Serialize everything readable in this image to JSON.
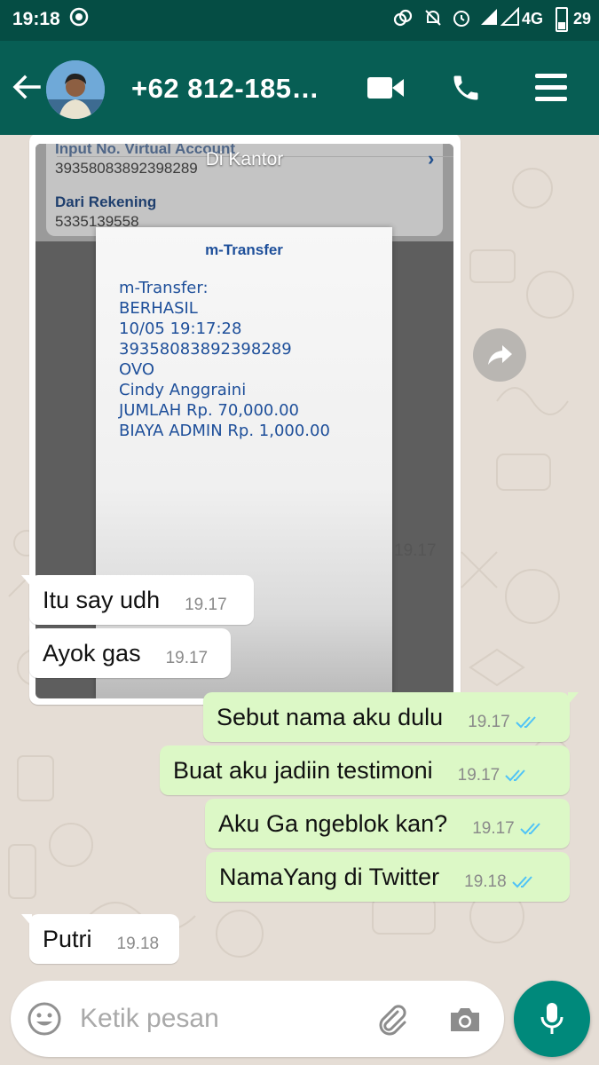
{
  "status_bar": {
    "time": "19:18",
    "network": "4G",
    "battery": "29"
  },
  "header": {
    "contact_name": "+62 812-185…"
  },
  "image_message": {
    "caption": "Di Kantor",
    "time": "19.17",
    "bank_form": {
      "field1_label": "Input No. Virtual Account",
      "field1_value": "39358083892398289",
      "field2_label": "Dari Rekening",
      "field2_value": "5335139558"
    },
    "receipt": {
      "title": "m-Transfer",
      "lines": [
        "m-Transfer:",
        "BERHASIL",
        "10/05 19:17:28",
        "39358083892398289",
        "OVO",
        "Cindy Anggraini",
        "JUMLAH Rp. 70,000.00",
        "BIAYA ADMIN Rp. 1,000.00"
      ]
    }
  },
  "messages": [
    {
      "direction": "in",
      "text": "Itu say udh",
      "time": "19.17"
    },
    {
      "direction": "in",
      "text": "Ayok gas",
      "time": "19.17"
    },
    {
      "direction": "out",
      "text": "Sebut nama aku dulu",
      "time": "19.17"
    },
    {
      "direction": "out",
      "text": "Buat aku jadiin testimoni",
      "time": "19.17"
    },
    {
      "direction": "out",
      "text": "Aku Ga ngeblok kan?",
      "time": "19.17"
    },
    {
      "direction": "out",
      "text": "NamaYang di Twitter",
      "time": "19.18"
    },
    {
      "direction": "in",
      "text": "Putri",
      "time": "19.18"
    }
  ],
  "input": {
    "placeholder": "Ketik pesan"
  },
  "colors": {
    "header": "#075e54",
    "status_bar": "#054d44",
    "outgoing_bubble": "#dcf8c6",
    "read_ticks": "#4fc3f7",
    "mic_button": "#00897b"
  },
  "icons": [
    "back-arrow-icon",
    "video-call-icon",
    "phone-icon",
    "menu-icon",
    "forward-icon",
    "emoji-icon",
    "attach-icon",
    "camera-icon",
    "mic-icon",
    "double-check-icon"
  ]
}
